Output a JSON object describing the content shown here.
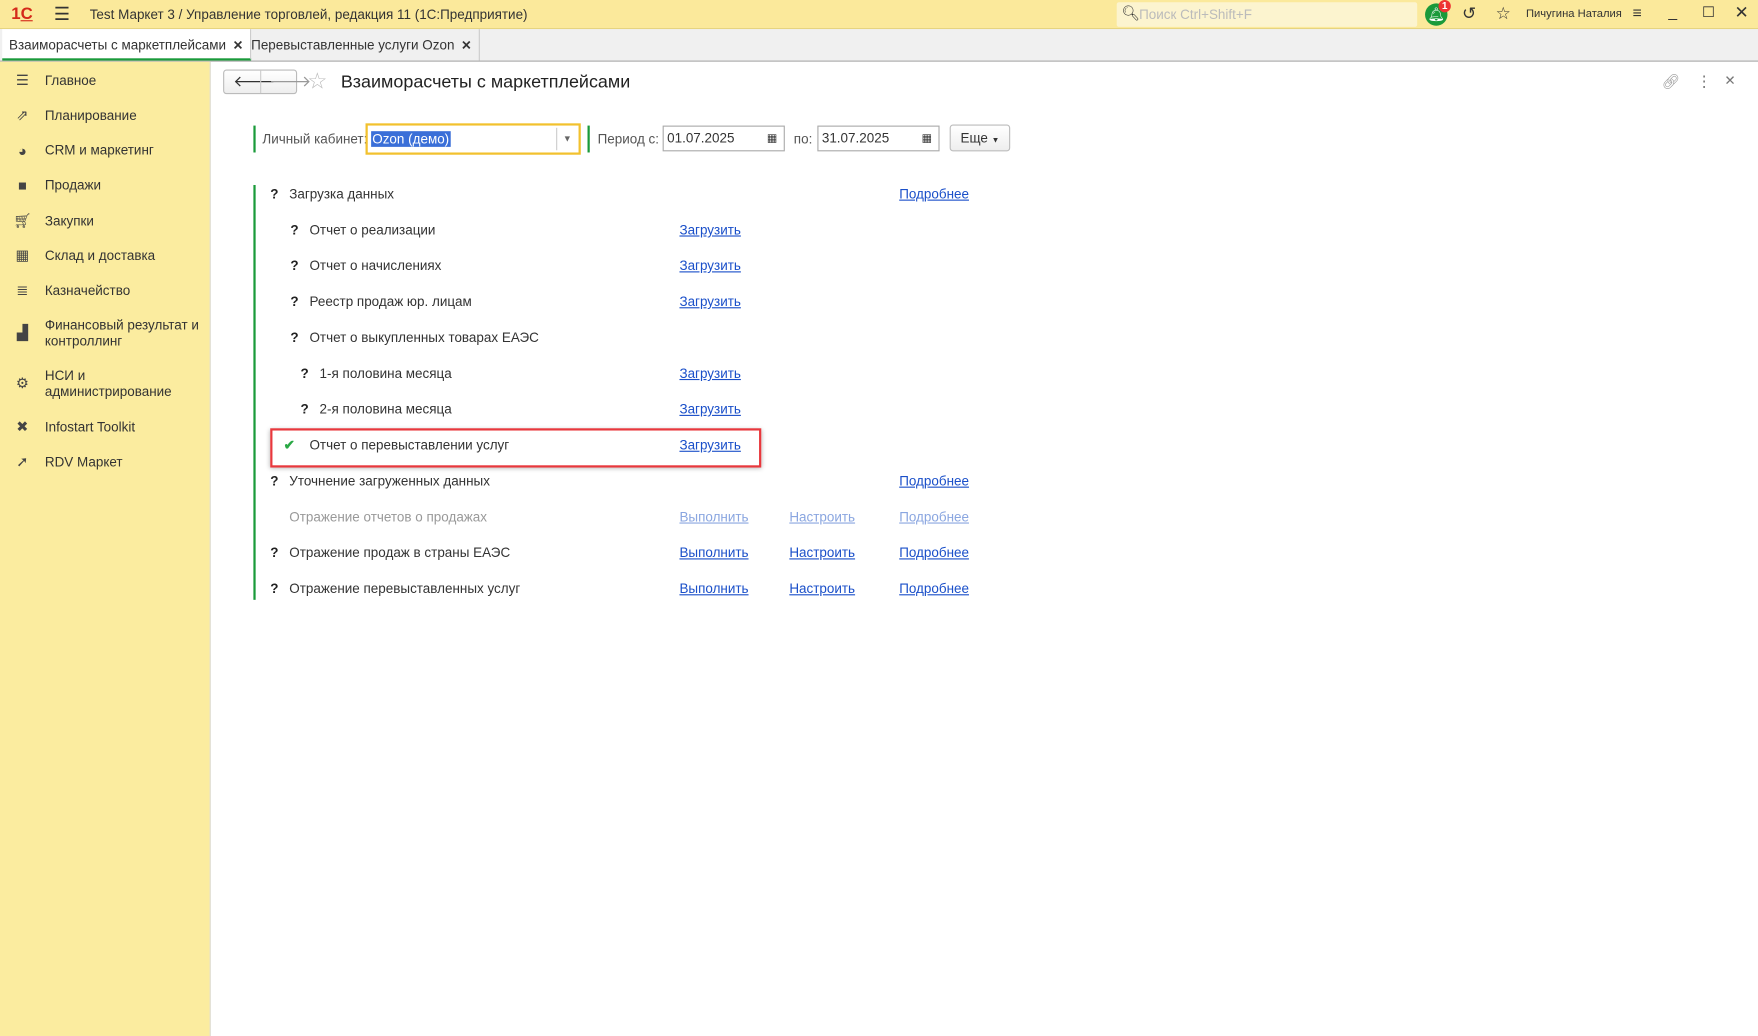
{
  "app": {
    "title": "Test Маркет 3 / Управление торговлей, редакция 11  (1С:Предприятие)",
    "search_placeholder": "Поиск Ctrl+Shift+F",
    "notifications": "1",
    "user": "Пичугина Наталия"
  },
  "tabs": [
    {
      "label": "Взаиморасчеты с маркетплейсами"
    },
    {
      "label": "Перевыставленные услуги Ozon"
    }
  ],
  "sidebar": {
    "items": [
      {
        "label": "Главное"
      },
      {
        "label": "Планирование"
      },
      {
        "label": "CRM и маркетинг"
      },
      {
        "label": "Продажи"
      },
      {
        "label": "Закупки"
      },
      {
        "label": "Склад и доставка"
      },
      {
        "label": "Казначейство"
      },
      {
        "label": "Финансовый результат и контроллинг"
      },
      {
        "label": "НСИ и администрирование"
      },
      {
        "label": "Infostart Toolkit"
      },
      {
        "label": "RDV Маркет"
      }
    ]
  },
  "form": {
    "title": "Взаиморасчеты с маркетплейсами",
    "cabinet_label": "Личный кабинет:",
    "cabinet_value": "Ozon (демо)",
    "period_from_label": "Период с:",
    "period_from": "01.07.2025",
    "period_to_label": "по:",
    "period_to": "31.07.2025",
    "more_label": "Еще"
  },
  "rows": [
    {
      "label": "Загрузка данных",
      "status": "?",
      "more": "Подробнее"
    },
    {
      "label": "Отчет о реализации",
      "status": "?",
      "load": "Загрузить"
    },
    {
      "label": "Отчет о начислениях",
      "status": "?",
      "load": "Загрузить"
    },
    {
      "label": "Реестр продаж юр. лицам",
      "status": "?",
      "load": "Загрузить"
    },
    {
      "label": "Отчет о выкупленных товарах ЕАЭС",
      "status": "?"
    },
    {
      "label": "1-я половина месяца",
      "status": "?",
      "load": "Загрузить"
    },
    {
      "label": "2-я половина месяца",
      "status": "?",
      "load": "Загрузить"
    },
    {
      "label": "Отчет о перевыставлении услуг",
      "status": "✔",
      "load": "Загрузить"
    },
    {
      "label": "Уточнение загруженных данных",
      "status": "?",
      "more": "Подробнее"
    },
    {
      "label": "Отражение отчетов о продажах",
      "run": "Выполнить",
      "setup": "Настроить",
      "more": "Подробнее"
    },
    {
      "label": "Отражение продаж в страны ЕАЭС",
      "status": "?",
      "run": "Выполнить",
      "setup": "Настроить",
      "more": "Подробнее"
    },
    {
      "label": "Отражение перевыставленных услуг",
      "status": "?",
      "run": "Выполнить",
      "setup": "Настроить",
      "more": "Подробнее"
    }
  ],
  "colors": {
    "accent": "#1a9a3a",
    "highlight": "#e8383d",
    "link": "#1a4fc9"
  }
}
